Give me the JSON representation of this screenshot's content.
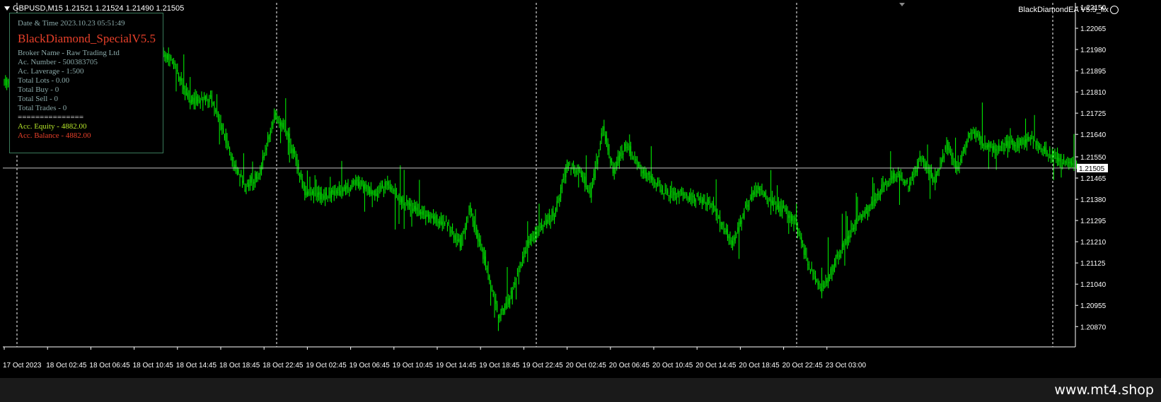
{
  "header": {
    "symbol_line": "GBPUSD,M15  1.21521 1.21524 1.21490 1.21505",
    "ea_label": "BlackDiamondEA  V5.5_fix"
  },
  "info_panel": {
    "datetime": "Date & Time 2023.10.23 05:51:49",
    "title": "BlackDiamond_SpecialV5.5",
    "broker": "Broker Name - Raw Trading Ltd",
    "account_number": "Ac. Number - 500383705",
    "leverage": "Ac. Laverage - 1:500",
    "total_lots": "Total Lots - 0.00",
    "total_buy": "Total Buy - 0",
    "total_sell": "Total Sell - 0",
    "total_trades": "Total Trades - 0",
    "separator": "===============",
    "equity": "Acc. Equity - 4882.00",
    "balance": "Acc. Balance - 4882.00"
  },
  "watermark": "www.mt4.shop",
  "colors": {
    "background": "#000000",
    "candle": "#00ff00",
    "axis_text": "#ffffff",
    "bid_line": "#c0c0c0",
    "price_tag_bg": "#ffffff",
    "price_tag_text": "#000000",
    "panel_border": "#3a7a5a",
    "title_red": "#e8402a",
    "equity_green": "#b8e82a"
  },
  "chart_data": {
    "type": "candlestick",
    "ylim": [
      1.208,
      1.2215
    ],
    "y_ticks": [
      "1.22150",
      "1.22065",
      "1.21980",
      "1.21895",
      "1.21810",
      "1.21725",
      "1.21640",
      "1.21550",
      "1.21465",
      "1.21380",
      "1.21295",
      "1.21210",
      "1.21125",
      "1.21040",
      "1.20955",
      "1.20870"
    ],
    "current_price": "1.21505",
    "x_ticks": [
      "17 Oct 2023",
      "18 Oct 02:45",
      "18 Oct 06:45",
      "18 Oct 10:45",
      "18 Oct 14:45",
      "18 Oct 18:45",
      "18 Oct 22:45",
      "19 Oct 02:45",
      "19 Oct 06:45",
      "19 Oct 10:45",
      "19 Oct 14:45",
      "19 Oct 18:45",
      "19 Oct 22:45",
      "20 Oct 02:45",
      "20 Oct 06:45",
      "20 Oct 10:45",
      "20 Oct 14:45",
      "20 Oct 18:45",
      "20 Oct 22:45",
      "23 Oct 03:00"
    ],
    "anchors": [
      [
        0,
        1.2185
      ],
      [
        6,
        1.2186
      ],
      [
        16,
        1.219
      ],
      [
        30,
        1.2187
      ],
      [
        50,
        1.217
      ],
      [
        70,
        1.2175
      ],
      [
        80,
        1.2162
      ],
      [
        95,
        1.2181
      ],
      [
        105,
        1.2187
      ],
      [
        115,
        1.2198
      ],
      [
        130,
        1.2195
      ],
      [
        145,
        1.2178
      ],
      [
        162,
        1.2178
      ],
      [
        175,
        1.216
      ],
      [
        188,
        1.2143
      ],
      [
        200,
        1.2148
      ],
      [
        212,
        1.2172
      ],
      [
        222,
        1.2165
      ],
      [
        236,
        1.2141
      ],
      [
        250,
        1.2139
      ],
      [
        262,
        1.2141
      ],
      [
        278,
        1.2145
      ],
      [
        290,
        1.214
      ],
      [
        300,
        1.2144
      ],
      [
        310,
        1.2138
      ],
      [
        325,
        1.2133
      ],
      [
        338,
        1.213
      ],
      [
        348,
        1.2128
      ],
      [
        358,
        1.212
      ],
      [
        365,
        1.2134
      ],
      [
        378,
        1.2112
      ],
      [
        388,
        1.209
      ],
      [
        398,
        1.21
      ],
      [
        410,
        1.212
      ],
      [
        420,
        1.2126
      ],
      [
        432,
        1.2132
      ],
      [
        442,
        1.2152
      ],
      [
        452,
        1.2149
      ],
      [
        460,
        1.214
      ],
      [
        470,
        1.2166
      ],
      [
        478,
        1.215
      ],
      [
        488,
        1.216
      ],
      [
        500,
        1.215
      ],
      [
        510,
        1.2145
      ],
      [
        520,
        1.214
      ],
      [
        532,
        1.214
      ],
      [
        545,
        1.2138
      ],
      [
        555,
        1.2136
      ],
      [
        565,
        1.2126
      ],
      [
        572,
        1.212
      ],
      [
        582,
        1.2135
      ],
      [
        592,
        1.2143
      ],
      [
        602,
        1.2136
      ],
      [
        612,
        1.2134
      ],
      [
        622,
        1.2128
      ],
      [
        632,
        1.211
      ],
      [
        642,
        1.2102
      ],
      [
        650,
        1.211
      ],
      [
        660,
        1.2121
      ],
      [
        670,
        1.213
      ],
      [
        680,
        1.2135
      ],
      [
        690,
        1.2143
      ],
      [
        700,
        1.2148
      ],
      [
        710,
        1.2143
      ],
      [
        720,
        1.2155
      ],
      [
        730,
        1.2145
      ],
      [
        740,
        1.216
      ],
      [
        748,
        1.215
      ],
      [
        758,
        1.2165
      ],
      [
        766,
        1.2162
      ],
      [
        776,
        1.2158
      ],
      [
        786,
        1.216
      ],
      [
        796,
        1.216
      ],
      [
        806,
        1.2162
      ],
      [
        816,
        1.2158
      ],
      [
        826,
        1.2155
      ],
      [
        834,
        1.2153
      ],
      [
        842,
        1.2151
      ],
      [
        843,
        1.21505
      ]
    ]
  }
}
